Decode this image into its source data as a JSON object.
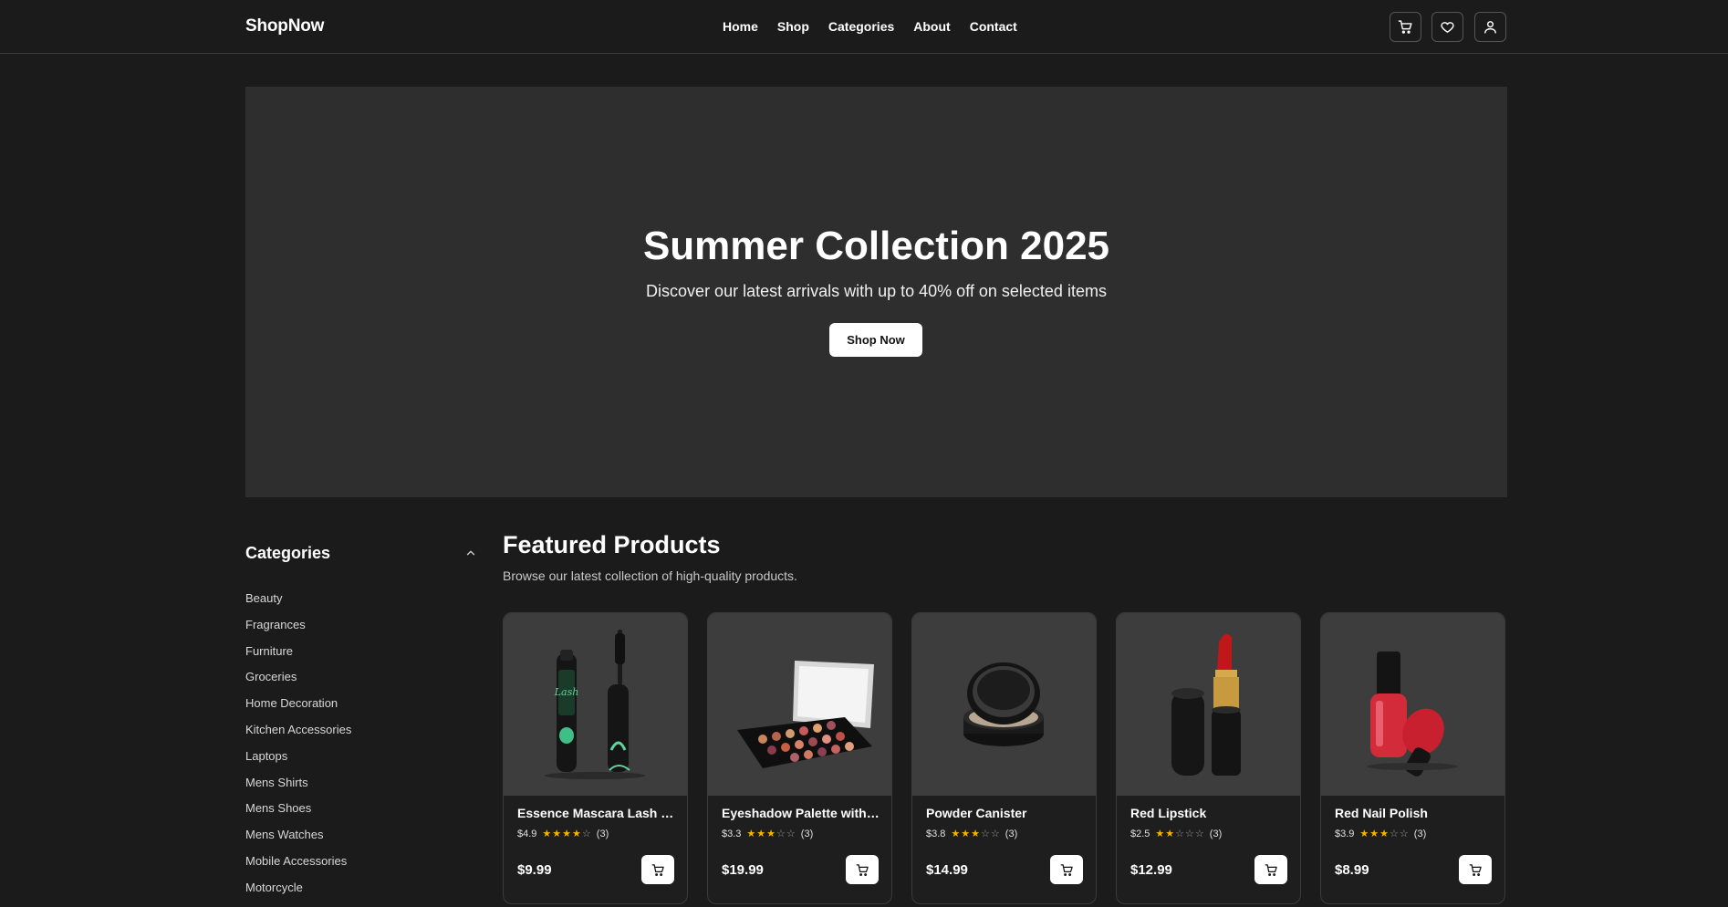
{
  "header": {
    "logo": "ShopNow",
    "nav": [
      "Home",
      "Shop",
      "Categories",
      "About",
      "Contact"
    ],
    "icons": [
      "cart-icon",
      "heart-icon",
      "user-icon"
    ]
  },
  "hero": {
    "title": "Summer Collection 2025",
    "subtitle": "Discover our latest arrivals with up to 40% off on selected items",
    "button": "Shop Now"
  },
  "sidebar": {
    "title": "Categories",
    "categories": [
      "Beauty",
      "Fragrances",
      "Furniture",
      "Groceries",
      "Home Decoration",
      "Kitchen Accessories",
      "Laptops",
      "Mens Shirts",
      "Mens Shoes",
      "Mens Watches",
      "Mobile Accessories",
      "Motorcycle"
    ]
  },
  "featured": {
    "title": "Featured Products",
    "subtitle": "Browse our latest collection of high-quality products.",
    "products": [
      {
        "name": "Essence Mascara Lash Princess",
        "rating": "$4.9",
        "stars": 4,
        "reviews": "(3)",
        "price": "$9.99",
        "image": "mascara"
      },
      {
        "name": "Eyeshadow Palette with Mirror",
        "rating": "$3.3",
        "stars": 3,
        "reviews": "(3)",
        "price": "$19.99",
        "image": "eyeshadow-palette"
      },
      {
        "name": "Powder Canister",
        "rating": "$3.8",
        "stars": 3,
        "reviews": "(3)",
        "price": "$14.99",
        "image": "powder-canister"
      },
      {
        "name": "Red Lipstick",
        "rating": "$2.5",
        "stars": 2,
        "reviews": "(3)",
        "price": "$12.99",
        "image": "lipstick"
      },
      {
        "name": "Red Nail Polish",
        "rating": "$3.9",
        "stars": 3,
        "reviews": "(3)",
        "price": "$8.99",
        "image": "nail-polish"
      }
    ]
  },
  "colors": {
    "background": "#1b1b1b",
    "hero": "#2e2e2e",
    "card_image_bg": "#3d3d3d",
    "star": "#f5b301"
  }
}
